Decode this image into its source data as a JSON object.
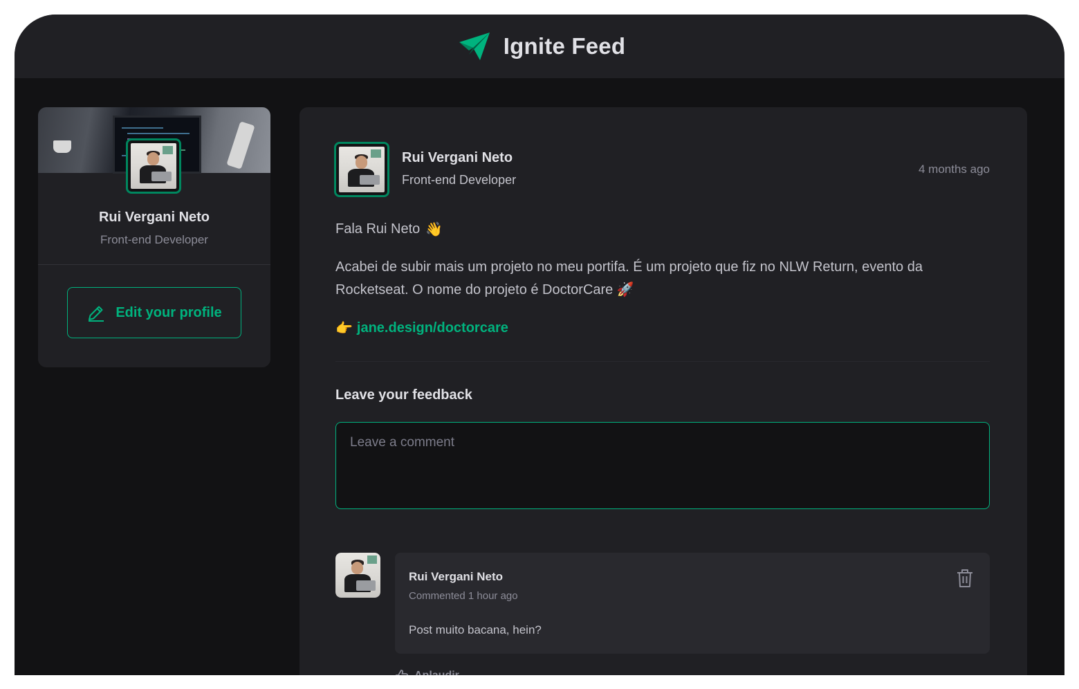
{
  "app": {
    "title": "Ignite Feed",
    "logo_icon": "paper-plane-logo-icon"
  },
  "colors": {
    "accent": "#00B37E",
    "accent_dark": "#00875F",
    "background": "#121214",
    "surface": "#202024"
  },
  "sidebar": {
    "name": "Rui Vergani Neto",
    "role": "Front-end Developer",
    "edit_button_label": "Edit your profile",
    "edit_icon": "pencil-icon"
  },
  "post": {
    "author_name": "Rui Vergani Neto",
    "author_role": "Front-end Developer",
    "published": "4 months ago",
    "greeting": "Fala Rui Neto",
    "greeting_emoji": "👋",
    "body": "Acabei de subir mais um projeto no meu portifa. É um projeto que fiz no NLW Return, evento da Rocketseat. O nome do projeto é DoctorCare",
    "body_emoji": "🚀",
    "link_emoji": "👉",
    "link": "jane.design/doctorcare"
  },
  "feedback": {
    "title": "Leave your feedback",
    "placeholder": "Leave a comment"
  },
  "comments": [
    {
      "author": "Rui Vergani Neto",
      "time": "Commented 1 hour ago",
      "text": "Post muito bacana, hein?",
      "delete_icon": "trash-icon",
      "applaud_label": "Aplaudir",
      "applaud_icon": "thumbs-up-icon"
    }
  ]
}
